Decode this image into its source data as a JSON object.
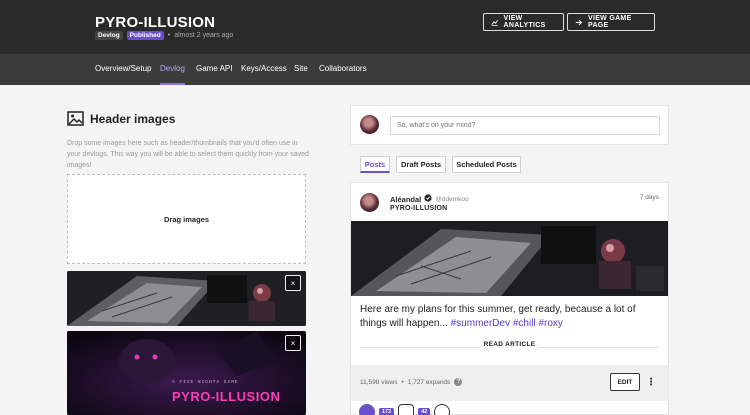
{
  "header": {
    "title": "PYRO-ILLUSION",
    "badge_devlog": "Devlog",
    "badge_published": "Published",
    "dot": "•",
    "time_ago": "almost 2 years ago",
    "btn_analytics": "VIEW ANALYTICS",
    "btn_game_page": "VIEW GAME PAGE"
  },
  "nav": {
    "items": [
      {
        "label": "Overview/Setup"
      },
      {
        "label": "Devlog"
      },
      {
        "label": "Game API"
      },
      {
        "label": "Keys/Access"
      },
      {
        "label": "Site"
      },
      {
        "label": "Collaborators"
      }
    ],
    "active": "Devlog"
  },
  "left": {
    "title": "Header images",
    "description": "Drop some images here such as header/thumbnails that you'd often use in your devlogs. This way you will be able to select them quickly from your saved images!",
    "dropzone_label": "Drag images",
    "thumb_close": "×",
    "thumb2_caption": "PYRO-ILLUSION"
  },
  "composer": {
    "placeholder": "So, what's on your mind?"
  },
  "tabs": [
    {
      "label": "Posts"
    },
    {
      "label": "Draft Posts"
    },
    {
      "label": "Scheduled Posts"
    }
  ],
  "post": {
    "author": "Aléandal",
    "handle": "@ddemkoo",
    "game": "PYRO-ILLUSION",
    "time": "7 days",
    "text_main": "Here are my plans for this summer, get ready, because a lot of things will happen...",
    "hashtags": [
      "#summerDev",
      "#chill",
      "#roxy"
    ],
    "read_article": "READ ARTICLE",
    "views": "11,598 views",
    "separator": "•",
    "expands": "1,727 expands",
    "help": "?",
    "edit": "EDIT",
    "more": "⋮",
    "like_count": "172",
    "comment_count": "42"
  },
  "colors": {
    "accent": "#6b4ecc",
    "header_bg": "#2a2a2a",
    "nav_bg": "#3b3b3b"
  }
}
